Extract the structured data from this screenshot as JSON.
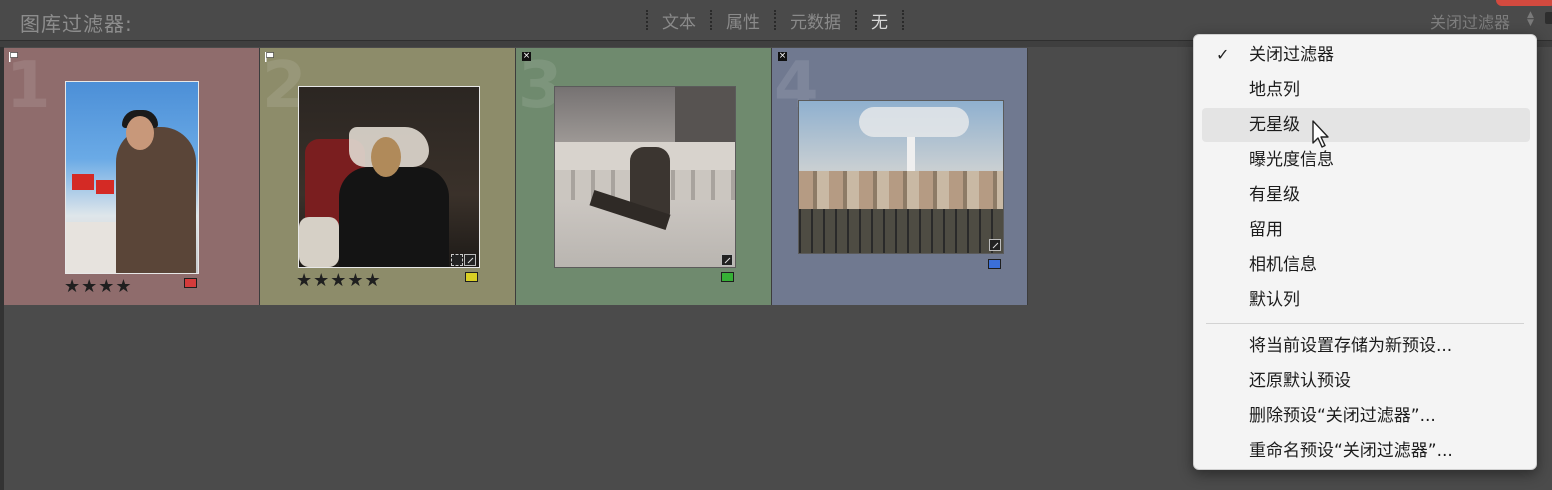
{
  "filter_bar": {
    "title": "图库过滤器:",
    "tabs": [
      {
        "label": "文本",
        "active": false
      },
      {
        "label": "属性",
        "active": false
      },
      {
        "label": "元数据",
        "active": false
      },
      {
        "label": "无",
        "active": true
      }
    ],
    "preset_label": "关闭过滤器"
  },
  "grid": {
    "cells": [
      {
        "index": "1",
        "flag": "flag",
        "stars": "★★★★",
        "label_color": "#d43b3b",
        "bg": "#8f6c6c"
      },
      {
        "index": "2",
        "flag": "flag",
        "stars": "★★★★★",
        "label_color": "#d9cf24",
        "bg": "#8d8c6a"
      },
      {
        "index": "3",
        "flag": "reject",
        "stars": "",
        "label_color": "#35b035",
        "bg": "#6f8a6e"
      },
      {
        "index": "4",
        "flag": "reject",
        "stars": "",
        "label_color": "#3b6fd9",
        "bg": "#707990"
      }
    ]
  },
  "menu": {
    "items": [
      {
        "label": "关闭过滤器",
        "checked": true
      },
      {
        "label": "地点列"
      },
      {
        "label": "无星级",
        "hovered": true
      },
      {
        "label": "曝光度信息"
      },
      {
        "label": "有星级"
      },
      {
        "label": "留用"
      },
      {
        "label": "相机信息"
      },
      {
        "label": "默认列"
      }
    ],
    "actions": [
      {
        "label": "将当前设置存储为新预设..."
      },
      {
        "label": "还原默认预设"
      },
      {
        "label": "删除预设“关闭过滤器”..."
      },
      {
        "label": "重命名预设“关闭过滤器”..."
      }
    ]
  }
}
